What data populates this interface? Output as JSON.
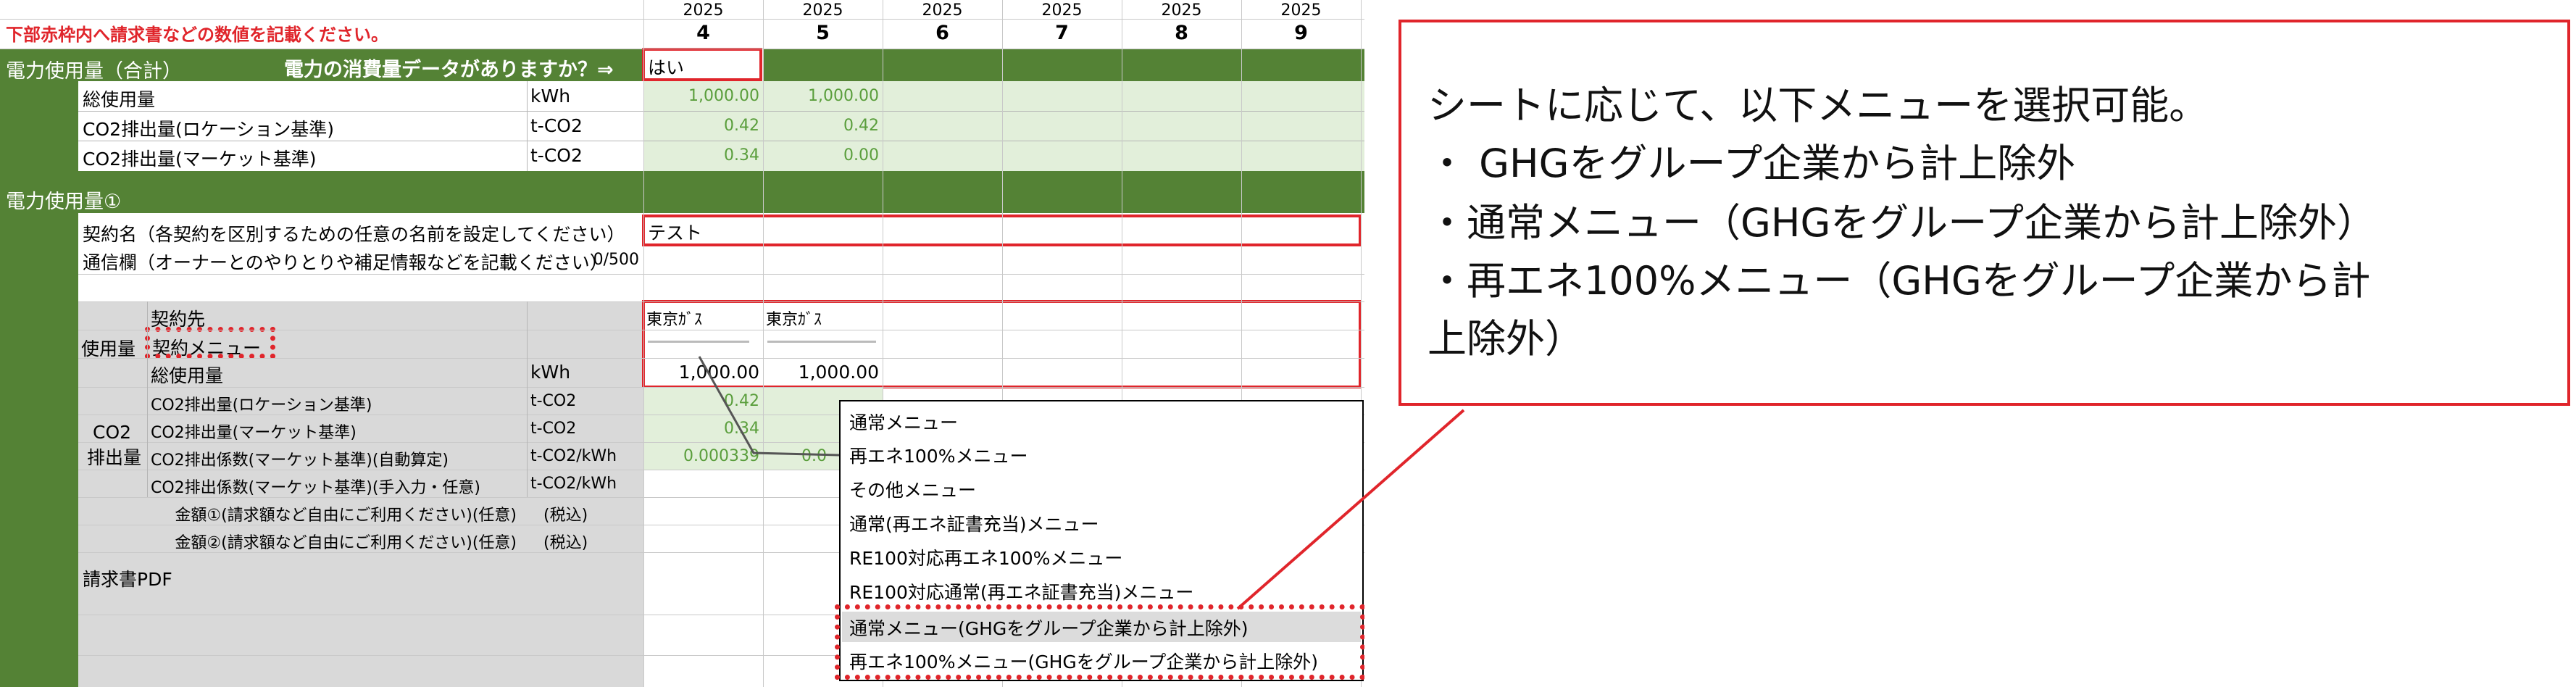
{
  "instruction": "下部赤枠内へ請求書などの数値を記載ください。",
  "columns": [
    {
      "year": "2025",
      "num": "4"
    },
    {
      "year": "2025",
      "num": "5"
    },
    {
      "year": "2025",
      "num": "6"
    },
    {
      "year": "2025",
      "num": "7"
    },
    {
      "year": "2025",
      "num": "8"
    },
    {
      "year": "2025",
      "num": "9"
    }
  ],
  "total_section": {
    "title": "電力使用量（合計）",
    "question": "電力の消費量データがありますか？⇒",
    "answer": "はい",
    "rows": [
      {
        "label": "総使用量",
        "unit": "kWh",
        "values": [
          "1,000.00",
          "1,000.00"
        ]
      },
      {
        "label": "CO2排出量(ロケーション基準)",
        "unit": "t-CO2",
        "values": [
          "0.42",
          "0.42"
        ]
      },
      {
        "label": "CO2排出量(マーケット基準)",
        "unit": "t-CO2",
        "values": [
          "0.34",
          "0.00"
        ]
      }
    ]
  },
  "usage1": {
    "title": "電力使用量①",
    "contract_name_label": "契約名（各契約を区別するための任意の名前を設定してください）",
    "contract_name_value": "テスト",
    "memo_label": "通信欄（オーナーとのやりとりや補足情報などを記載ください）",
    "memo_count": "0/500",
    "usage_group_label": "使用量",
    "supplier_label": "契約先",
    "supplier_values": [
      "東京ｶﾞｽ",
      "東京ｶﾞｽ"
    ],
    "menu_label": "契約メニュー",
    "total_label": "総使用量",
    "total_unit": "kWh",
    "total_values": [
      "1,000.00",
      "1,000.00"
    ],
    "co2_group_label": [
      "CO2",
      "排出量"
    ],
    "co2_rows": [
      {
        "label": "CO2排出量(ロケーション基準)",
        "unit": "t-CO2",
        "values": [
          "0.42",
          ""
        ]
      },
      {
        "label": "CO2排出量(マーケット基準)",
        "unit": "t-CO2",
        "values": [
          "0.34",
          ""
        ]
      },
      {
        "label": "CO2排出係数(マーケット基準)(自動算定)",
        "unit": "t-CO2/kWh",
        "values": [
          "0.000339",
          "0.0"
        ]
      },
      {
        "label": "CO2排出係数(マーケット基準)(手入力・任意)",
        "unit": "t-CO2/kWh",
        "values": [
          "",
          ""
        ]
      }
    ],
    "amount1_label": "金額①(請求額など自由にご利用ください)(任意)",
    "amount1_tax": "(税込)",
    "amount2_label": "金額②(請求額など自由にご利用ください)(任意)",
    "amount2_tax": "(税込)",
    "invoice_pdf_label": "請求書PDF"
  },
  "dropdown": {
    "options": [
      "通常メニュー",
      "再エネ100%メニュー",
      "その他メニュー",
      "通常(再エネ証書充当)メニュー",
      "RE100対応再エネ100%メニュー",
      "RE100対応通常(再エネ証書充当)メニュー",
      "通常メニュー(GHGをグループ企業から計上除外)",
      "再エネ100%メニュー(GHGをグループ企業から計上除外)"
    ]
  },
  "callout": {
    "lines": [
      "シートに応じて、以下メニューを選択可能。",
      "・ GHGをグループ企業から計上除外",
      "・通常メニュー（GHGをグループ企業から計上除外）",
      "・再エネ100%メニュー（GHGをグループ企業から計",
      "上除外）"
    ]
  },
  "colors": {
    "header_green": "#548235",
    "light_green": "#e2efda",
    "highlight_red": "#e0252b",
    "value_green": "#5a9e3c"
  }
}
